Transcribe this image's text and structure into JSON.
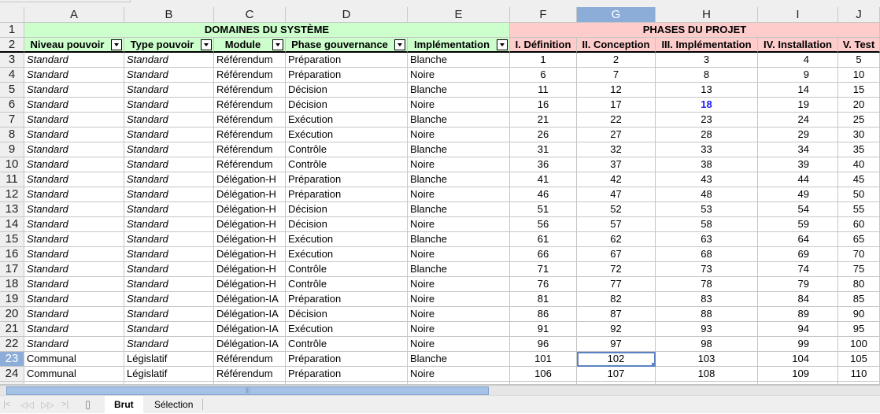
{
  "columns": [
    "A",
    "B",
    "C",
    "D",
    "E",
    "F",
    "G",
    "H",
    "I",
    "J"
  ],
  "selected_column": "G",
  "selected_row": 23,
  "selected_cell": "G23",
  "colors": {
    "domain_header": "#ccffcc",
    "phase_header": "#ffcccc",
    "selection": "#8badd8",
    "highlight_value": "#1a1aff"
  },
  "row1": {
    "domains": "DOMAINES DU SYSTÈME",
    "phases": "PHASES DU PROJET"
  },
  "headers": [
    "Niveau pouvoir",
    "Type pouvoir",
    "Module",
    "Phase gouvernance",
    "Implémentation",
    "I. Définition",
    "II. Conception",
    "III. Implémentation",
    "IV. Installation",
    "V. Test"
  ],
  "highlighted_cell": "H6",
  "rows": [
    [
      "Standard",
      "Standard",
      "Référendum",
      "Préparation",
      "Blanche",
      1,
      2,
      3,
      4,
      5
    ],
    [
      "Standard",
      "Standard",
      "Référendum",
      "Préparation",
      "Noire",
      6,
      7,
      8,
      9,
      10
    ],
    [
      "Standard",
      "Standard",
      "Référendum",
      "Décision",
      "Blanche",
      11,
      12,
      13,
      14,
      15
    ],
    [
      "Standard",
      "Standard",
      "Référendum",
      "Décision",
      "Noire",
      16,
      17,
      18,
      19,
      20
    ],
    [
      "Standard",
      "Standard",
      "Référendum",
      "Exécution",
      "Blanche",
      21,
      22,
      23,
      24,
      25
    ],
    [
      "Standard",
      "Standard",
      "Référendum",
      "Exécution",
      "Noire",
      26,
      27,
      28,
      29,
      30
    ],
    [
      "Standard",
      "Standard",
      "Référendum",
      "Contrôle",
      "Blanche",
      31,
      32,
      33,
      34,
      35
    ],
    [
      "Standard",
      "Standard",
      "Référendum",
      "Contrôle",
      "Noire",
      36,
      37,
      38,
      39,
      40
    ],
    [
      "Standard",
      "Standard",
      "Délégation-H",
      "Préparation",
      "Blanche",
      41,
      42,
      43,
      44,
      45
    ],
    [
      "Standard",
      "Standard",
      "Délégation-H",
      "Préparation",
      "Noire",
      46,
      47,
      48,
      49,
      50
    ],
    [
      "Standard",
      "Standard",
      "Délégation-H",
      "Décision",
      "Blanche",
      51,
      52,
      53,
      54,
      55
    ],
    [
      "Standard",
      "Standard",
      "Délégation-H",
      "Décision",
      "Noire",
      56,
      57,
      58,
      59,
      60
    ],
    [
      "Standard",
      "Standard",
      "Délégation-H",
      "Exécution",
      "Blanche",
      61,
      62,
      63,
      64,
      65
    ],
    [
      "Standard",
      "Standard",
      "Délégation-H",
      "Exécution",
      "Noire",
      66,
      67,
      68,
      69,
      70
    ],
    [
      "Standard",
      "Standard",
      "Délégation-H",
      "Contrôle",
      "Blanche",
      71,
      72,
      73,
      74,
      75
    ],
    [
      "Standard",
      "Standard",
      "Délégation-H",
      "Contrôle",
      "Noire",
      76,
      77,
      78,
      79,
      80
    ],
    [
      "Standard",
      "Standard",
      "Délégation-IA",
      "Préparation",
      "Noire",
      81,
      82,
      83,
      84,
      85
    ],
    [
      "Standard",
      "Standard",
      "Délégation-IA",
      "Décision",
      "Noire",
      86,
      87,
      88,
      89,
      90
    ],
    [
      "Standard",
      "Standard",
      "Délégation-IA",
      "Exécution",
      "Noire",
      91,
      92,
      93,
      94,
      95
    ],
    [
      "Standard",
      "Standard",
      "Délégation-IA",
      "Contrôle",
      "Noire",
      96,
      97,
      98,
      99,
      100
    ],
    [
      "Communal",
      "Législatif",
      "Référendum",
      "Préparation",
      "Blanche",
      101,
      102,
      103,
      104,
      105
    ],
    [
      "Communal",
      "Législatif",
      "Référendum",
      "Préparation",
      "Noire",
      106,
      107,
      108,
      109,
      110
    ]
  ],
  "sheet_tabs": [
    {
      "label": "Brut",
      "active": true
    },
    {
      "label": "Sélection",
      "active": false
    }
  ]
}
